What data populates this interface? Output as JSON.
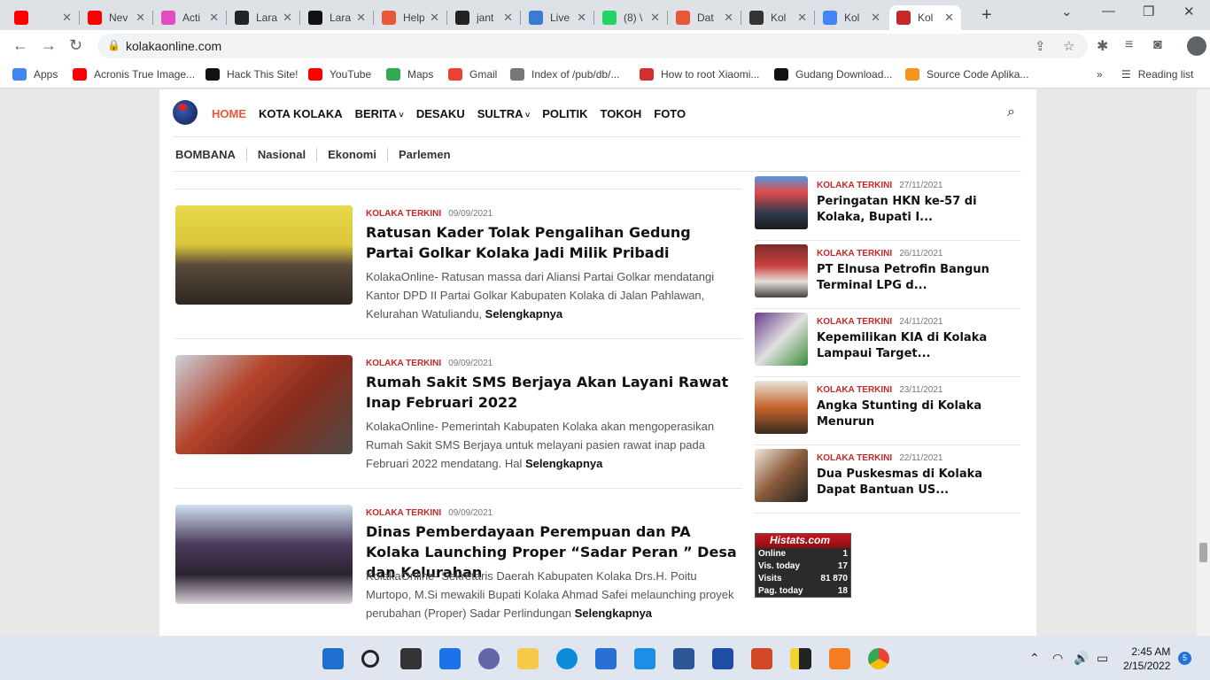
{
  "browser": {
    "tabs": [
      {
        "title": "",
        "color": "#ff0000"
      },
      {
        "title": "Nev",
        "color": "#ff0000"
      },
      {
        "title": "Acti",
        "color": "#e14cc2"
      },
      {
        "title": "Lara",
        "color": "#222222"
      },
      {
        "title": "Lara",
        "color": "#111111"
      },
      {
        "title": "Help",
        "color": "#e8573a"
      },
      {
        "title": "jant",
        "color": "#222222"
      },
      {
        "title": "Live",
        "color": "#3a7bd5"
      },
      {
        "title": "(8) \\",
        "color": "#25d366"
      },
      {
        "title": "Dat",
        "color": "#e8573a"
      },
      {
        "title": "Kol",
        "color": "#333333"
      },
      {
        "title": "Kol",
        "color": "#4285f4"
      },
      {
        "title": "Kol",
        "color": "#c62828"
      }
    ],
    "url": "kolakaonline.com",
    "bookmarks": [
      {
        "label": "Apps",
        "color": "#4285f4"
      },
      {
        "label": "Acronis True Image...",
        "color": "#ff0000"
      },
      {
        "label": "Hack This Site!",
        "color": "#111111"
      },
      {
        "label": "YouTube",
        "color": "#ff0000"
      },
      {
        "label": "Maps",
        "color": "#34a853"
      },
      {
        "label": "Gmail",
        "color": "#ea4335"
      },
      {
        "label": "Index of /pub/db/...",
        "color": "#777777"
      },
      {
        "label": "How to root Xiaomi...",
        "color": "#d32f2f"
      },
      {
        "label": "Gudang Download...",
        "color": "#111111"
      },
      {
        "label": "Source Code Aplika...",
        "color": "#f7941d"
      }
    ],
    "reading_list": "Reading list"
  },
  "site": {
    "nav": [
      {
        "label": "HOME",
        "dropdown": false
      },
      {
        "label": "KOTA KOLAKA",
        "dropdown": false
      },
      {
        "label": "BERITA",
        "dropdown": true
      },
      {
        "label": "DESAKU",
        "dropdown": false
      },
      {
        "label": "SULTRA",
        "dropdown": true
      },
      {
        "label": "POLITIK",
        "dropdown": false
      },
      {
        "label": "TOKOH",
        "dropdown": false
      },
      {
        "label": "FOTO",
        "dropdown": false
      }
    ],
    "subnav": [
      "BOMBANA",
      "Nasional",
      "Ekonomi",
      "Parlemen"
    ],
    "articles": [
      {
        "category": "KOLAKA TERKINI",
        "date": "09/09/2021",
        "title": "Ratusan Kader Tolak Pengalihan Gedung Partai Golkar Kolaka Jadi Milik Pribadi",
        "excerpt": "KolakaOnline-  Ratusan massa dari Aliansi Partai Golkar mendatangi Kantor DPD II Partai Golkar Kabupaten Kolaka  di Jalan Pahlawan, Kelurahan Watuliandu, ",
        "more": "Selengkapnya"
      },
      {
        "category": "KOLAKA TERKINI",
        "date": "09/09/2021",
        "title": "Rumah Sakit SMS Berjaya Akan Layani  Rawat Inap Februari 2022",
        "excerpt": "KolakaOnline-  Pemerintah Kabupaten Kolaka akan mengoperasikan Rumah Sakit SMS Berjaya untuk melayani pasien rawat inap pada Februari 2022 mendatang. Hal ",
        "more": "Selengkapnya"
      },
      {
        "category": "KOLAKA TERKINI",
        "date": "09/09/2021",
        "title": "Dinas Pemberdayaan Perempuan dan PA Kolaka Launching Proper “Sadar Peran ” Desa dan Kelurahan",
        "excerpt": "KolakaOnline- Sekretaris Daerah Kabupaten Kolaka Drs.H. Poitu Murtopo, M.Si  mewakili Bupati Kolaka Ahmad Safei  melaunching proyek perubahan (Proper) Sadar Perlindungan  ",
        "more": "Selengkapnya"
      }
    ],
    "sidebar": [
      {
        "category": "KOLAKA TERKINI",
        "date": "27/11/2021",
        "title": "Peringatan HKN ke-57 di Kolaka, Bupati I..."
      },
      {
        "category": "KOLAKA TERKINI",
        "date": "26/11/2021",
        "title": "PT Elnusa Petrofin Bangun Terminal LPG d..."
      },
      {
        "category": "KOLAKA TERKINI",
        "date": "24/11/2021",
        "title": "Kepemilikan KIA di Kolaka Lampaui Target..."
      },
      {
        "category": "KOLAKA TERKINI",
        "date": "23/11/2021",
        "title": "Angka Stunting di Kolaka Menurun"
      },
      {
        "category": "KOLAKA TERKINI",
        "date": "22/11/2021",
        "title": "Dua Puskesmas di Kolaka Dapat Bantuan US..."
      }
    ],
    "histats": {
      "title": "Histats.com",
      "rows": [
        {
          "label": "Online",
          "value": "1"
        },
        {
          "label": "Vis. today",
          "value": "17"
        },
        {
          "label": "Visits",
          "value": "81 870"
        },
        {
          "label": "Pag. today",
          "value": "18"
        }
      ]
    }
  },
  "taskbar": {
    "time": "2:45 AM",
    "date": "2/15/2022",
    "notifications": "5"
  }
}
